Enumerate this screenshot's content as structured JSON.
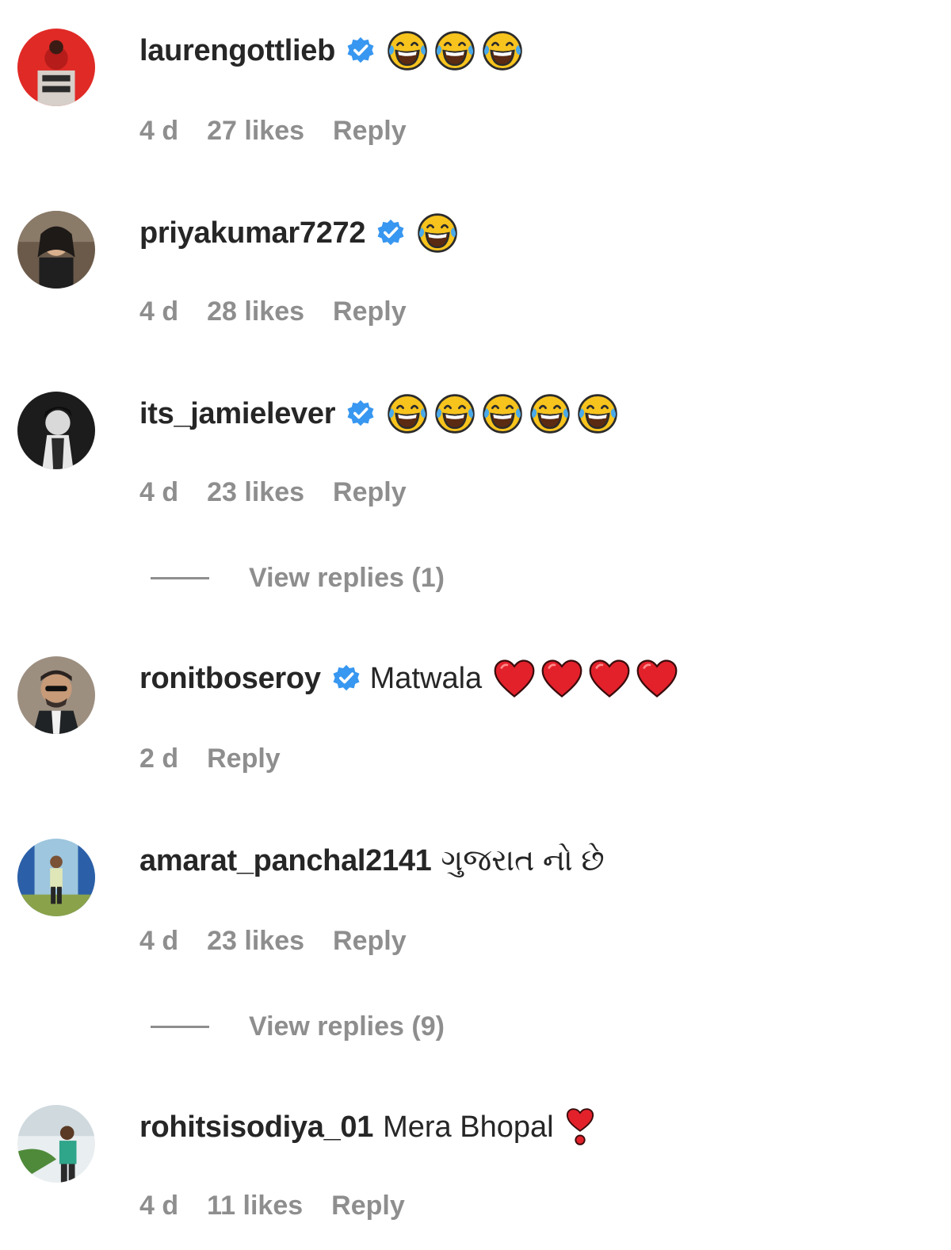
{
  "comments": [
    {
      "username": "laurengottlieb",
      "verified": true,
      "text": "",
      "emojis": [
        "tears-of-joy",
        "tears-of-joy",
        "tears-of-joy"
      ],
      "time": "4 d",
      "likes": "27 likes",
      "reply": "Reply"
    },
    {
      "username": "priyakumar7272",
      "verified": true,
      "text": "",
      "emojis": [
        "tears-of-joy"
      ],
      "time": "4 d",
      "likes": "28 likes",
      "reply": "Reply"
    },
    {
      "username": "its_jamielever",
      "verified": true,
      "text": "",
      "emojis": [
        "tears-of-joy",
        "tears-of-joy",
        "tears-of-joy",
        "tears-of-joy",
        "tears-of-joy"
      ],
      "time": "4 d",
      "likes": "23 likes",
      "reply": "Reply",
      "view_replies": "View replies (1)"
    },
    {
      "username": "ronitboseroy",
      "verified": true,
      "text": "Matwala",
      "emojis": [
        "red-heart",
        "red-heart",
        "red-heart",
        "red-heart"
      ],
      "time": "2 d",
      "reply": "Reply"
    },
    {
      "username": "amarat_panchal2141",
      "verified": false,
      "text": "ગુજરાત નો છે",
      "emojis": [],
      "time": "4 d",
      "likes": "23 likes",
      "reply": "Reply",
      "view_replies": "View replies (9)"
    },
    {
      "username": "rohitsisodiya_01",
      "verified": false,
      "text": "Mera Bhopal",
      "emojis": [
        "heart-exclamation"
      ],
      "time": "4 d",
      "likes": "11 likes",
      "reply": "Reply"
    }
  ],
  "colors": {
    "text": "#262626",
    "secondary": "#8e8e8e",
    "verified": "#3897f0",
    "heart": "#e3212b",
    "emoji_face": "#f7c31d"
  }
}
